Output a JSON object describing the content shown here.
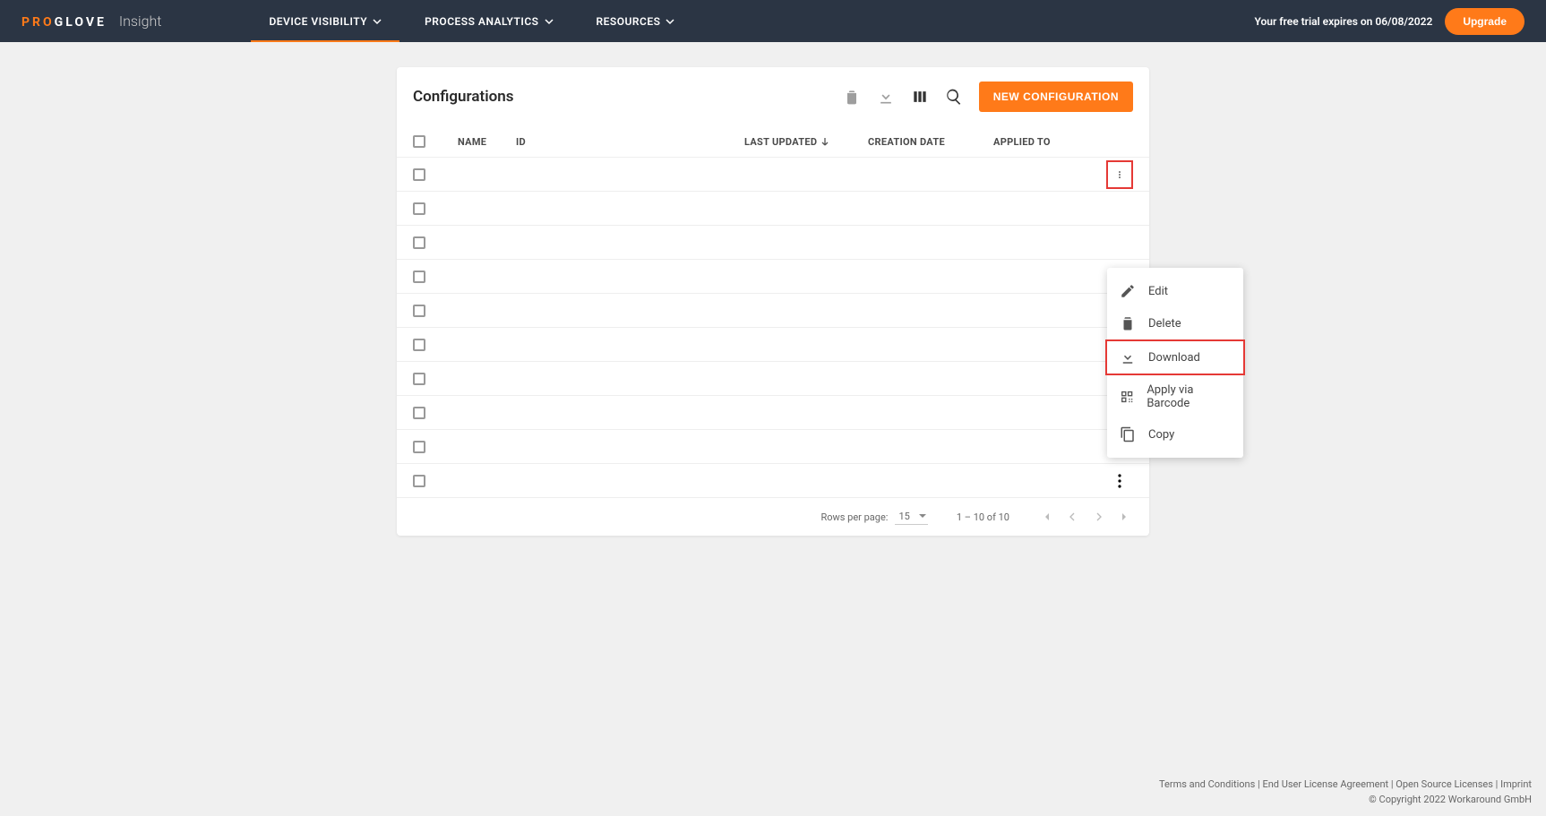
{
  "header": {
    "logo_pro": "PRO",
    "logo_glove": "GLOVE",
    "logo_insight": "Insight",
    "nav": {
      "device": "DEVICE VISIBILITY",
      "process": "PROCESS ANALYTICS",
      "resources": "RESOURCES"
    },
    "trial_text": "Your free trial expires on 06/08/2022",
    "upgrade": "Upgrade"
  },
  "card": {
    "title": "Configurations",
    "new_button": "NEW CONFIGURATION",
    "columns": {
      "name": "NAME",
      "id": "ID",
      "last_updated": "LAST UPDATED",
      "creation_date": "CREATION DATE",
      "applied_to": "APPLIED TO"
    }
  },
  "context_menu": {
    "edit": "Edit",
    "delete": "Delete",
    "download": "Download",
    "barcode": "Apply via Barcode",
    "copy": "Copy"
  },
  "pagination": {
    "rows_label": "Rows per page:",
    "rows_value": "15",
    "range": "1 – 10 of 10"
  },
  "footer": {
    "terms": "Terms and Conditions",
    "eula": "End User License Agreement",
    "open_source": "Open Source Licenses",
    "imprint": "Imprint",
    "copyright": "© Copyright 2022 Workaround GmbH"
  }
}
